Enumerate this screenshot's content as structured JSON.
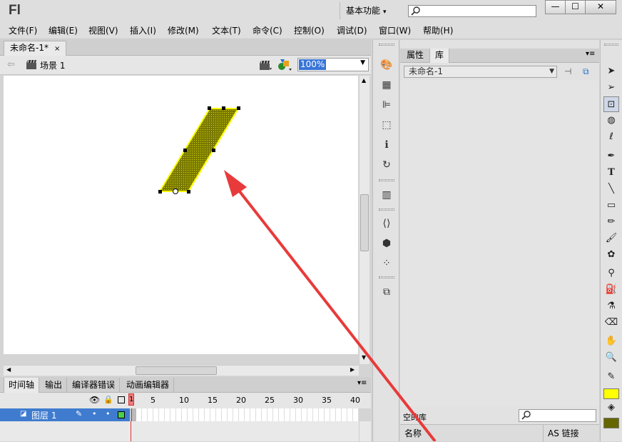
{
  "app": {
    "logo": "Fl"
  },
  "header": {
    "workspace_label": "基本功能",
    "search_placeholder": ""
  },
  "window_buttons": [
    "—",
    "☐",
    "✕"
  ],
  "menu": [
    "文件(F)",
    "编辑(E)",
    "视图(V)",
    "插入(I)",
    "修改(M)",
    "文本(T)",
    "命令(C)",
    "控制(O)",
    "调试(D)",
    "窗口(W)",
    "帮助(H)"
  ],
  "document": {
    "tab_title": "未命名-1*",
    "close_glyph": "×",
    "scene_label": "场景 1",
    "zoom_value": "100%"
  },
  "timeline": {
    "tabs": [
      "时间轴",
      "输出",
      "编译器错误",
      "动画编辑器"
    ],
    "frame_numbers": [
      "1",
      "5",
      "10",
      "15",
      "20",
      "25",
      "30",
      "35",
      "40"
    ],
    "layer_name": "图层 1"
  },
  "library": {
    "tabs": [
      "属性",
      "库"
    ],
    "document_select": "未命名-1",
    "empty_label": "空的库",
    "col_name": "名称",
    "col_linkage": "AS 链接"
  },
  "colors": {
    "stroke_swatch": "#ffff00",
    "fill_swatch": "#666600",
    "shape_fill": "#7a7a00",
    "arrow": "#e83a3a",
    "selection": "#3875d7"
  },
  "tools": [
    "selection-arrow-icon",
    "subselection-icon",
    "free-transform-icon",
    "3d-rotation-icon",
    "lasso-icon",
    "pen-icon",
    "text-icon",
    "line-icon",
    "rectangle-icon",
    "pencil-icon",
    "brush-icon",
    "deco-icon",
    "bone-icon",
    "paint-bucket-icon",
    "eyedropper-icon",
    "eraser-icon",
    "hand-icon",
    "zoom-icon"
  ]
}
